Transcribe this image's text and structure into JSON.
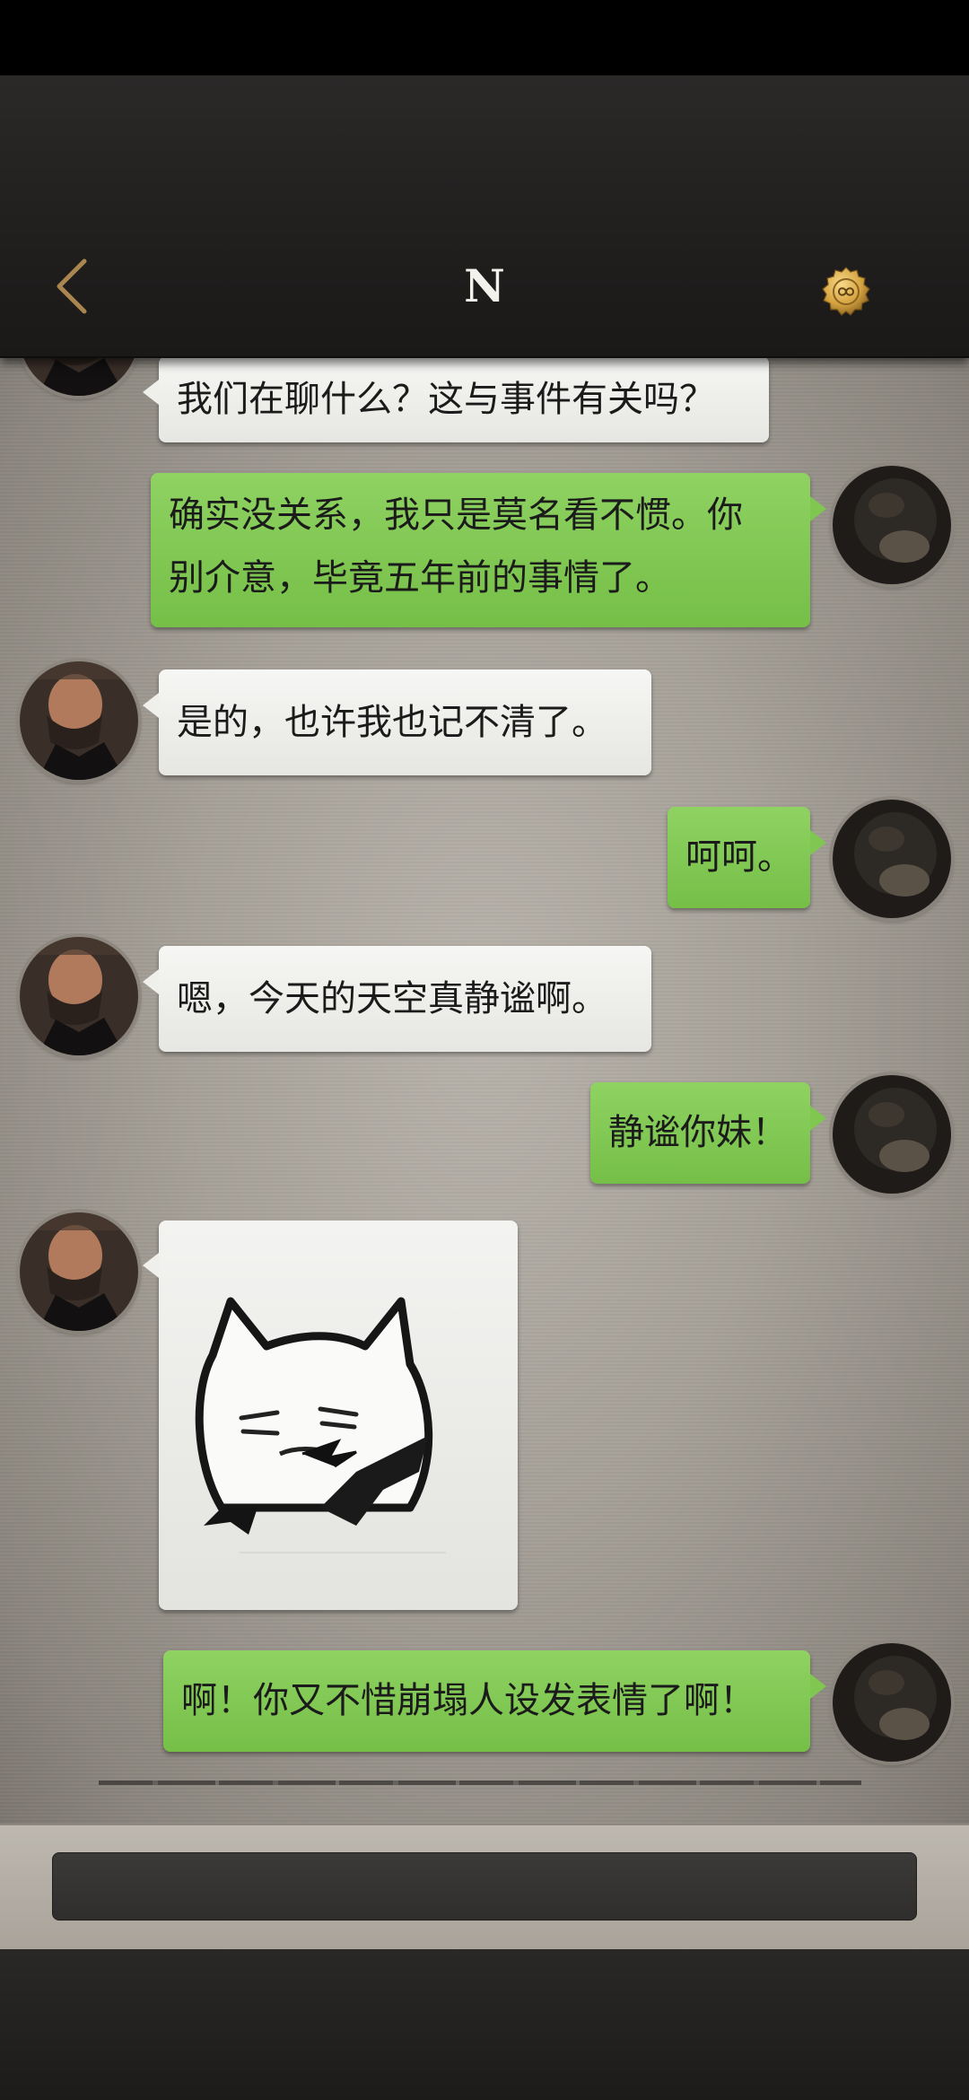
{
  "header": {
    "title": "N",
    "back_icon": "chevron-left-icon",
    "coin_icon": "gold-coin-icon",
    "accent": "#b08a4f"
  },
  "messages": [
    {
      "side": "in",
      "text": "我们在聊什么？这与事件有关吗？"
    },
    {
      "side": "out",
      "lines": [
        "确实没关系，我只是莫名看不惯。你",
        "别介意，毕竟五年前的事情了。"
      ]
    },
    {
      "side": "in",
      "text": "是的，也许我也记不清了。"
    },
    {
      "side": "out",
      "text": "呵呵。"
    },
    {
      "side": "in",
      "text": "嗯，今天的天空真静谧啊。"
    },
    {
      "side": "out",
      "text": "静谧你妹！"
    },
    {
      "side": "in",
      "sticker": "cat-meme-sticker"
    },
    {
      "side": "out",
      "text": "啊！你又不惜崩塌人设发表情了啊！"
    }
  ],
  "colors": {
    "bubble_in": "#eeeeeb",
    "bubble_out": "#7fc750",
    "background": "#a49f97"
  },
  "input": {
    "value": "",
    "placeholder": ""
  }
}
